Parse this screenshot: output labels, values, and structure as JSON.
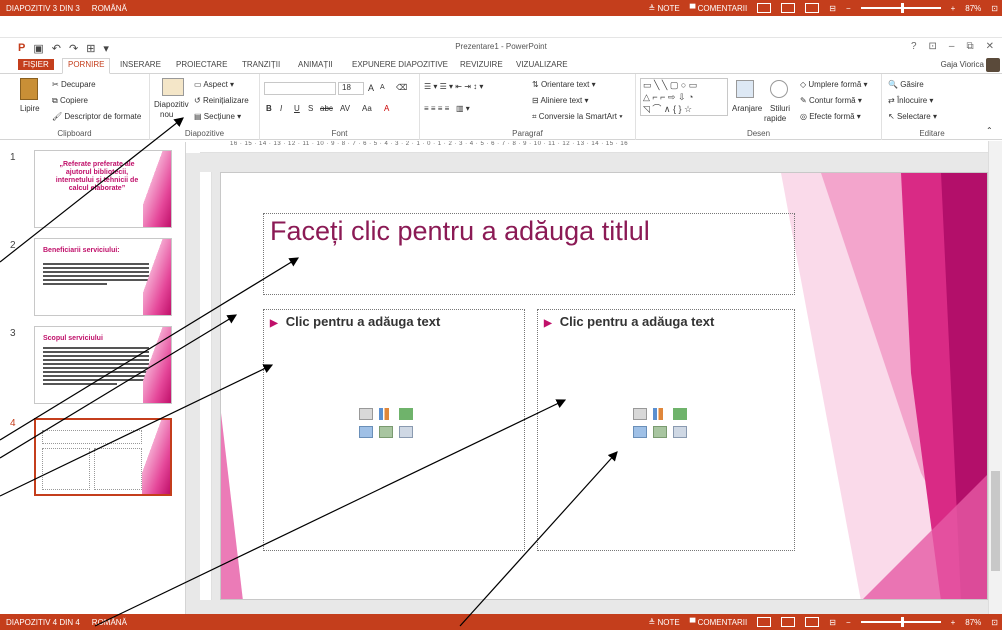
{
  "top_status": {
    "slide_info": "DIAPOZITIV 3 DIN 3",
    "language": "ROMÂNĂ",
    "notes": "NOTE",
    "comments": "COMENTARII",
    "zoom": "87%"
  },
  "bottom_status": {
    "slide_info": "DIAPOZITIV 4 DIN 4",
    "language": "ROMÂNĂ",
    "notes": "NOTE",
    "comments": "COMENTARII",
    "zoom": "87%"
  },
  "window": {
    "title": "Prezentare1 - PowerPoint",
    "user": "Gaja Viorica",
    "help": "?"
  },
  "tabs": [
    "FIȘIER",
    "PORNIRE",
    "INSERARE",
    "PROIECTARE",
    "TRANZIȚII",
    "ANIMAȚII",
    "EXPUNERE DIAPOZITIVE",
    "REVIZUIRE",
    "VIZUALIZARE"
  ],
  "ribbon": {
    "clipboard": {
      "label": "Clipboard",
      "paste": "Lipire",
      "cut": "Decupare",
      "copy": "Copiere",
      "format_painter": "Descriptor de formate"
    },
    "slides": {
      "label": "Diapozitive",
      "new_slide_1": "Diapozitiv",
      "new_slide_2": "nou",
      "layout": "Aspect",
      "reset": "Reinițializare",
      "section": "Secțiune"
    },
    "font": {
      "label": "Font",
      "size": "18",
      "bold": "B",
      "italic": "I",
      "underline": "U",
      "shadow": "S",
      "strike": "abc",
      "spacing": "AV",
      "case": "Aa",
      "color": "A",
      "grow": "A",
      "shrink": "A"
    },
    "paragraph": {
      "label": "Paragraf",
      "text_direction": "Orientare text",
      "align_text": "Aliniere text",
      "smartart": "Conversie la SmartArt"
    },
    "drawing": {
      "label": "Desen",
      "arrange": "Aranjare",
      "quick_styles_1": "Stiluri",
      "quick_styles_2": "rapide",
      "shape_fill": "Umplere formă",
      "shape_outline": "Contur formă",
      "shape_effects": "Efecte formă"
    },
    "editing": {
      "label": "Editare",
      "find": "Găsire",
      "replace": "Înlocuire",
      "select": "Selectare"
    }
  },
  "ruler_text": "16 · 15 · 14 · 13 · 12 · 11 · 10 · 9 · 8 · 7 · 6 · 5 · 4 · 3 · 2 · 1 · 0 · 1 · 2 · 3 · 4 · 5 · 6 · 7 · 8 · 9 · 10 · 11 · 12 · 13 · 14 · 15 · 16",
  "thumbnails": [
    {
      "num": "1",
      "title": "„Referate preferate ale ajutorul bibliotecii, internetului și tehnicii de calcul elaborate”"
    },
    {
      "num": "2",
      "title": "Beneficiarii serviciului:"
    },
    {
      "num": "3",
      "title": "Scopul serviciului"
    },
    {
      "num": "4",
      "title": ""
    }
  ],
  "slide": {
    "title_placeholder": "Faceți clic pentru a adăuga titlul",
    "left_placeholder": "Clic pentru a adăuga text",
    "right_placeholder": "Clic pentru a adăuga text"
  },
  "colors": {
    "accent": "#c43e1c",
    "pink": "#c0106a",
    "title_text": "#8b1a55"
  }
}
